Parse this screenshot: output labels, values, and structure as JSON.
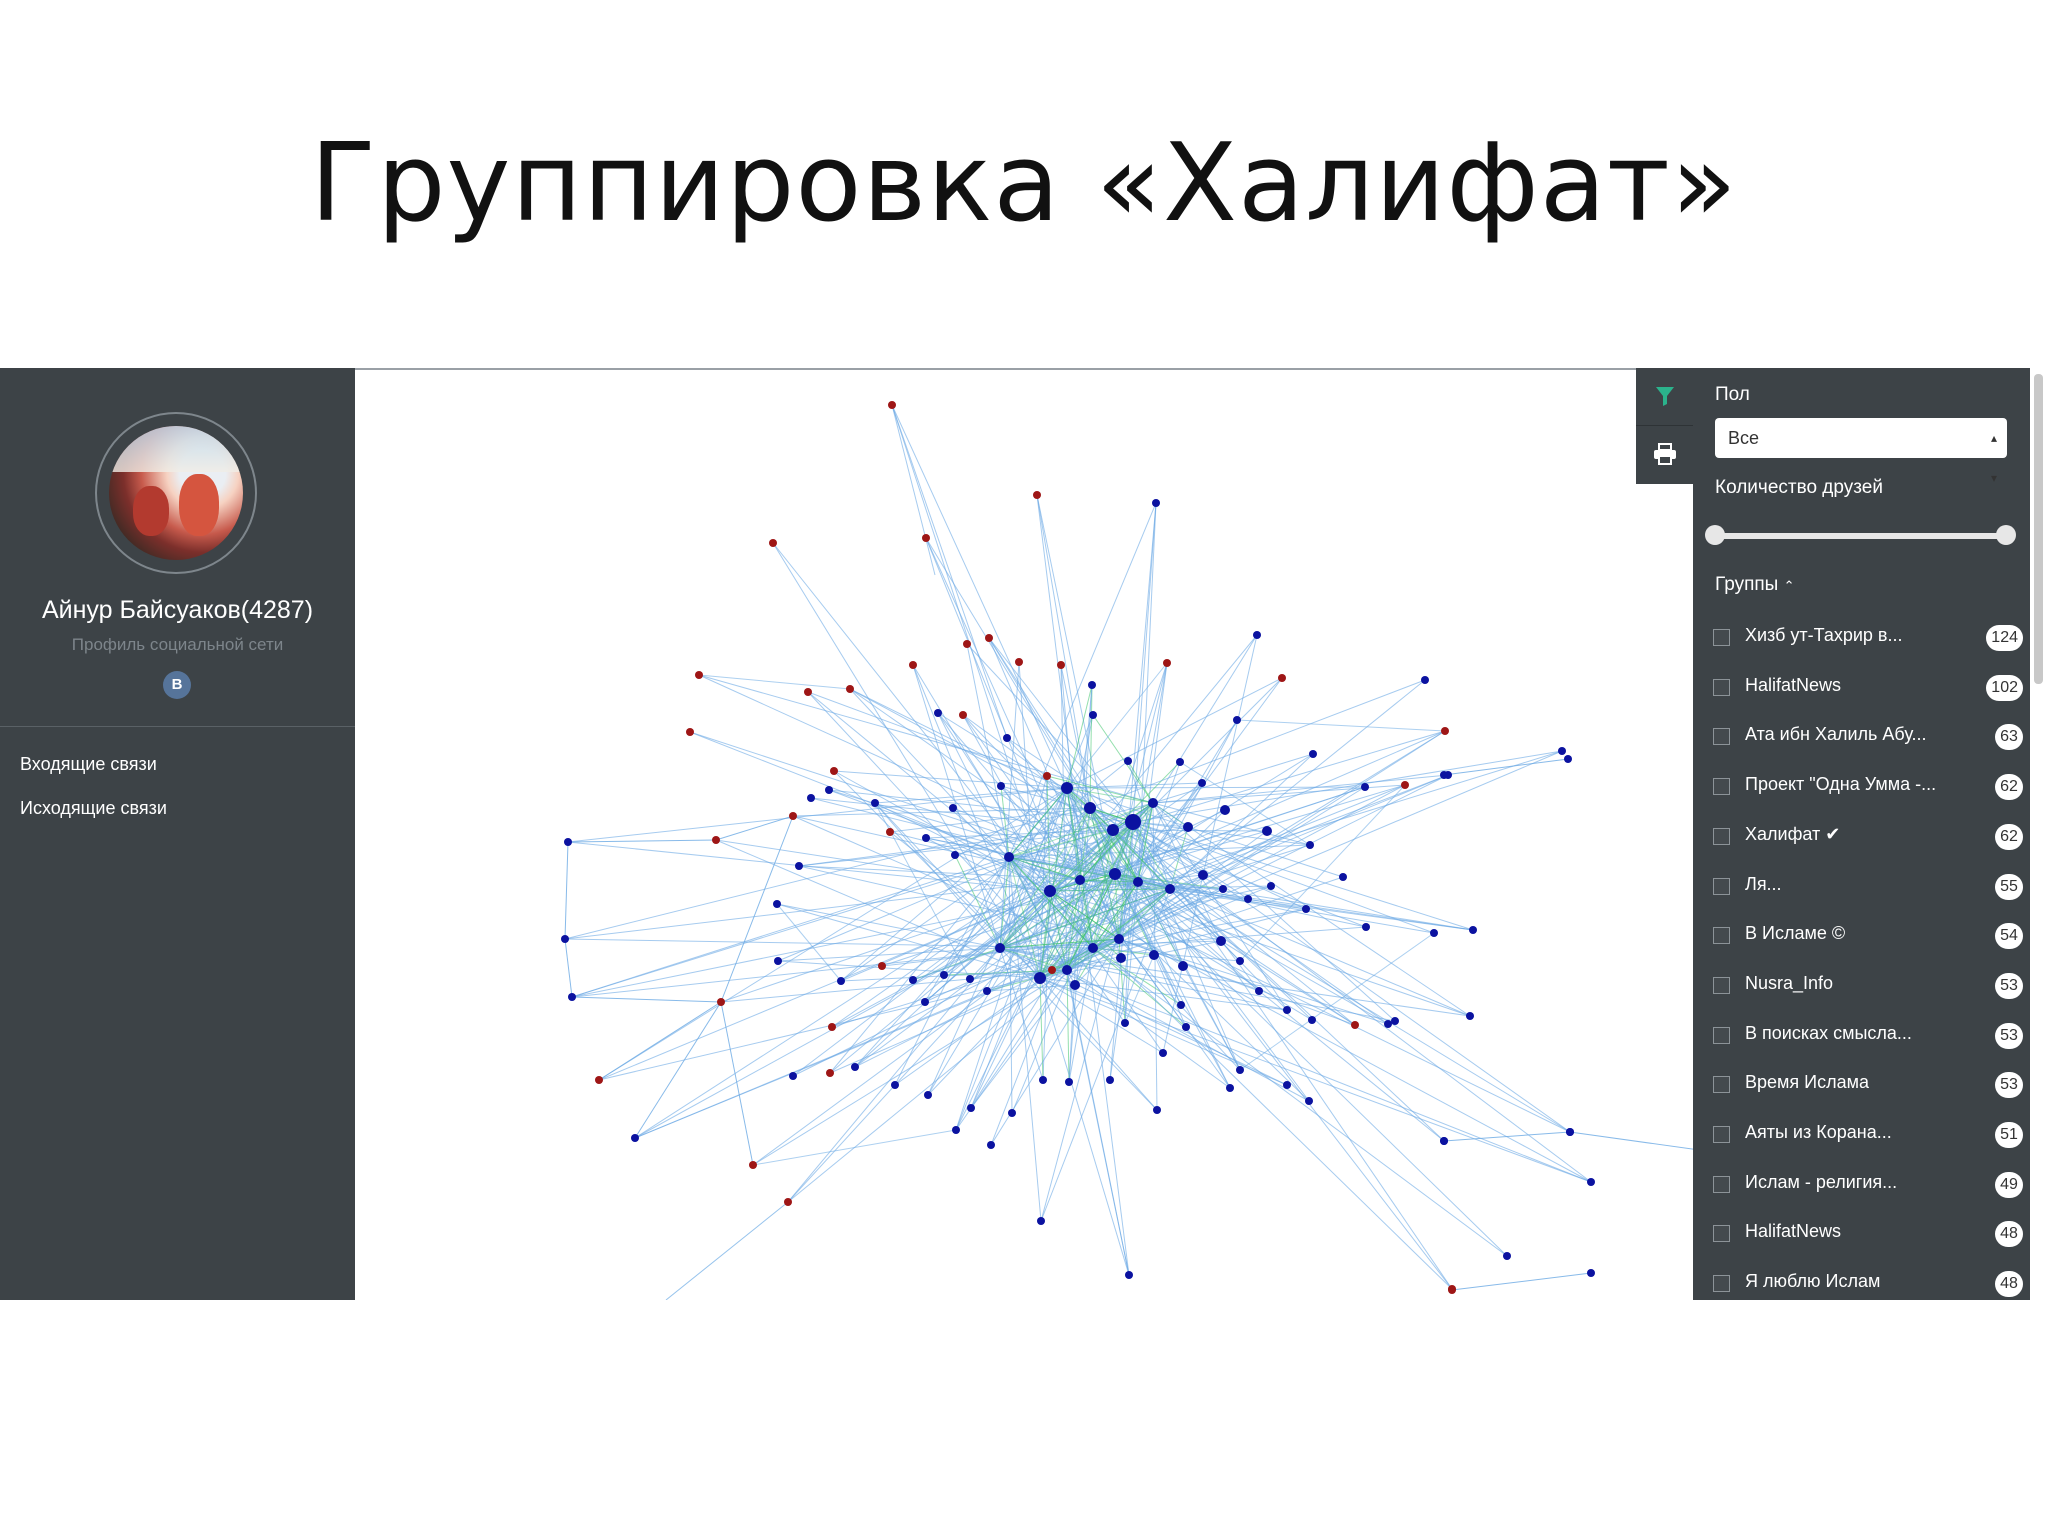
{
  "slide": {
    "title": "Группировка «Халифат»"
  },
  "profile": {
    "name": "Айнур Байсуаков(4287)",
    "subtitle": "Профиль социальной сети",
    "network_badge": "B",
    "avatar_icon": "user-avatar-photo"
  },
  "nav": {
    "incoming": "Входящие связи",
    "outgoing": "Исходящие связи"
  },
  "toolbar": {
    "filter_icon": "filter-icon",
    "print_icon": "print-icon"
  },
  "filters": {
    "gender_label": "Пол",
    "gender_value": "Все",
    "friends_label": "Количество друзей",
    "groups_label": "Группы",
    "groups": [
      {
        "name": "Хизб ут-Тахрир в...",
        "count": "124"
      },
      {
        "name": "HalifatNews",
        "count": "102"
      },
      {
        "name": "Ата ибн Халиль Абу...",
        "count": "63"
      },
      {
        "name": "Проект \"Одна Умма -...",
        "count": "62"
      },
      {
        "name": "Халифат ✔",
        "count": "62"
      },
      {
        "name": "Ля...",
        "count": "55"
      },
      {
        "name": "В Исламе ©",
        "count": "54"
      },
      {
        "name": "Nusra_Info",
        "count": "53"
      },
      {
        "name": "В поисках смысла...",
        "count": "53"
      },
      {
        "name": "Время Ислама",
        "count": "53"
      },
      {
        "name": "Аяты из Корана...",
        "count": "51"
      },
      {
        "name": "Ислам - религия...",
        "count": "49"
      },
      {
        "name": "HalifatNews",
        "count": "48"
      },
      {
        "name": "Я люблю Ислам",
        "count": "48"
      }
    ]
  },
  "graph": {
    "colors": {
      "blue_node": "#0b12a0",
      "red_node": "#9e1616",
      "edge_blue": "#6aa9e4",
      "edge_green": "#3cc46a"
    }
  }
}
